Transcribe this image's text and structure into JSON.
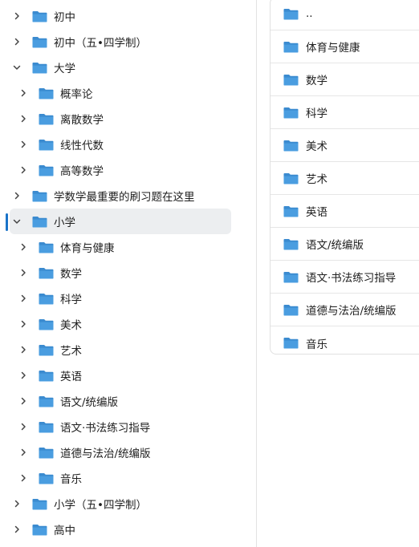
{
  "tree": {
    "items": [
      {
        "label": "初中",
        "expanded": false,
        "level": 0
      },
      {
        "label": "初中（五•四学制）",
        "expanded": false,
        "level": 0
      },
      {
        "label": "大学",
        "expanded": true,
        "level": 0
      },
      {
        "label": "概率论",
        "expanded": false,
        "level": 1
      },
      {
        "label": "离散数学",
        "expanded": false,
        "level": 1
      },
      {
        "label": "线性代数",
        "expanded": false,
        "level": 1
      },
      {
        "label": "高等数学",
        "expanded": false,
        "level": 1
      },
      {
        "label": "学数学最重要的刷习题在这里",
        "expanded": false,
        "level": 0
      },
      {
        "label": "小学",
        "expanded": true,
        "level": 0,
        "selected": true
      },
      {
        "label": "体育与健康",
        "expanded": false,
        "level": 1
      },
      {
        "label": "数学",
        "expanded": false,
        "level": 1
      },
      {
        "label": "科学",
        "expanded": false,
        "level": 1
      },
      {
        "label": "美术",
        "expanded": false,
        "level": 1
      },
      {
        "label": "艺术",
        "expanded": false,
        "level": 1
      },
      {
        "label": "英语",
        "expanded": false,
        "level": 1
      },
      {
        "label": "语文/统编版",
        "expanded": false,
        "level": 1
      },
      {
        "label": "语文·书法练习指导",
        "expanded": false,
        "level": 1
      },
      {
        "label": "道德与法治/统编版",
        "expanded": false,
        "level": 1
      },
      {
        "label": "音乐",
        "expanded": false,
        "level": 1
      },
      {
        "label": "小学（五•四学制）",
        "expanded": false,
        "level": 0
      },
      {
        "label": "高中",
        "expanded": false,
        "level": 0
      }
    ]
  },
  "list": {
    "items": [
      {
        "label": ".."
      },
      {
        "label": "体育与健康"
      },
      {
        "label": "数学"
      },
      {
        "label": "科学"
      },
      {
        "label": "美术"
      },
      {
        "label": "艺术"
      },
      {
        "label": "英语"
      },
      {
        "label": "语文/统编版"
      },
      {
        "label": "语文·书法练习指导"
      },
      {
        "label": "道德与法治/统编版"
      },
      {
        "label": "音乐"
      }
    ]
  },
  "colors": {
    "folder": "#4a9de0",
    "folder_tab": "#3b8bd0",
    "selected_bg": "#eceef0",
    "indicator": "#1a73c8"
  }
}
